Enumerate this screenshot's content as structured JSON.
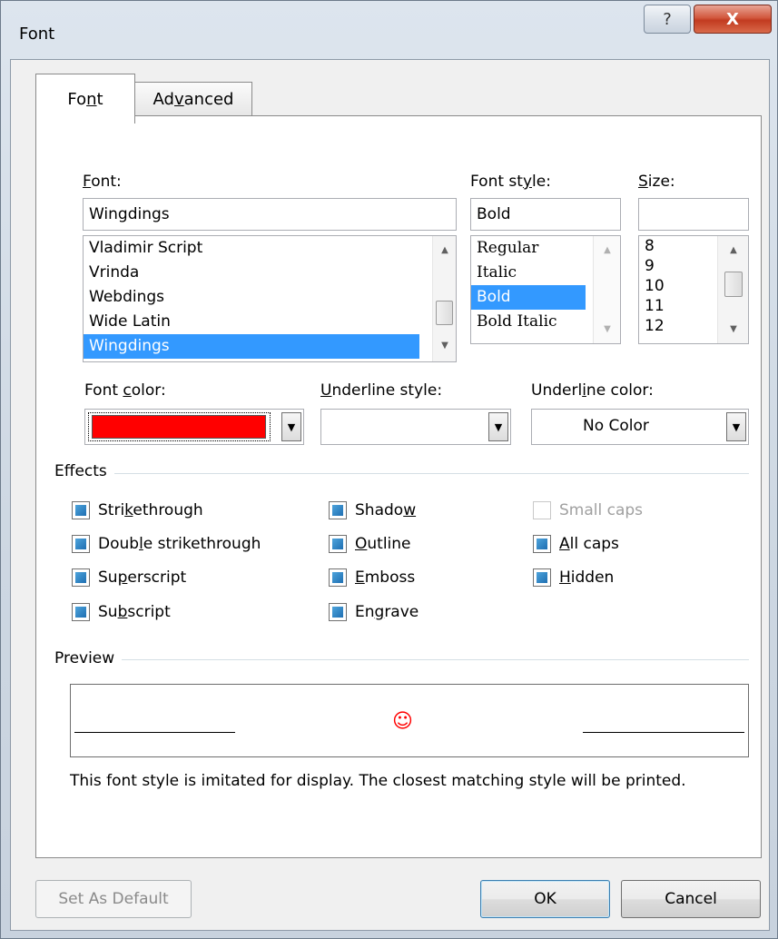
{
  "window": {
    "title": "Font",
    "help_glyph": "?",
    "close_glyph": "X"
  },
  "tabs": [
    {
      "label": "Font",
      "access_key": "n",
      "active": true
    },
    {
      "label": "Advanced",
      "access_key": "v",
      "active": false
    }
  ],
  "font": {
    "label": "Font:",
    "value": "Wingdings",
    "list": [
      "Vladimir Script",
      "Vrinda",
      "Webdings",
      "Wide Latin",
      "Wingdings"
    ],
    "selected": "Wingdings"
  },
  "font_style": {
    "label": "Font style:",
    "value": "Bold",
    "list": [
      "Regular",
      "Italic",
      "Bold",
      "Bold Italic"
    ],
    "selected": "Bold"
  },
  "size": {
    "label": "Size:",
    "value": "",
    "list": [
      "8",
      "9",
      "10",
      "11",
      "12"
    ]
  },
  "font_color": {
    "label": "Font color:",
    "swatch": "#ff0000"
  },
  "underline_style": {
    "label": "Underline style:",
    "value": ""
  },
  "underline_color": {
    "label": "Underline color:",
    "value": "No Color"
  },
  "effects": {
    "title": "Effects",
    "col1": [
      "Strikethrough",
      "Double strikethrough",
      "Superscript",
      "Subscript"
    ],
    "col2": [
      "Shadow",
      "Outline",
      "Emboss",
      "Engrave"
    ],
    "col3": [
      "Small caps",
      "All caps",
      "Hidden"
    ],
    "disabled": [
      "Small caps"
    ]
  },
  "preview": {
    "title": "Preview",
    "sample": "☺",
    "note": "This font style is imitated for display. The closest matching style will be printed."
  },
  "buttons": {
    "set_default": "Set As Default",
    "ok": "OK",
    "cancel": "Cancel"
  },
  "colors": {
    "selection": "#3399ff",
    "checkbox_indeterminate": "#1f6fb2",
    "close_button": "#c23b20"
  }
}
